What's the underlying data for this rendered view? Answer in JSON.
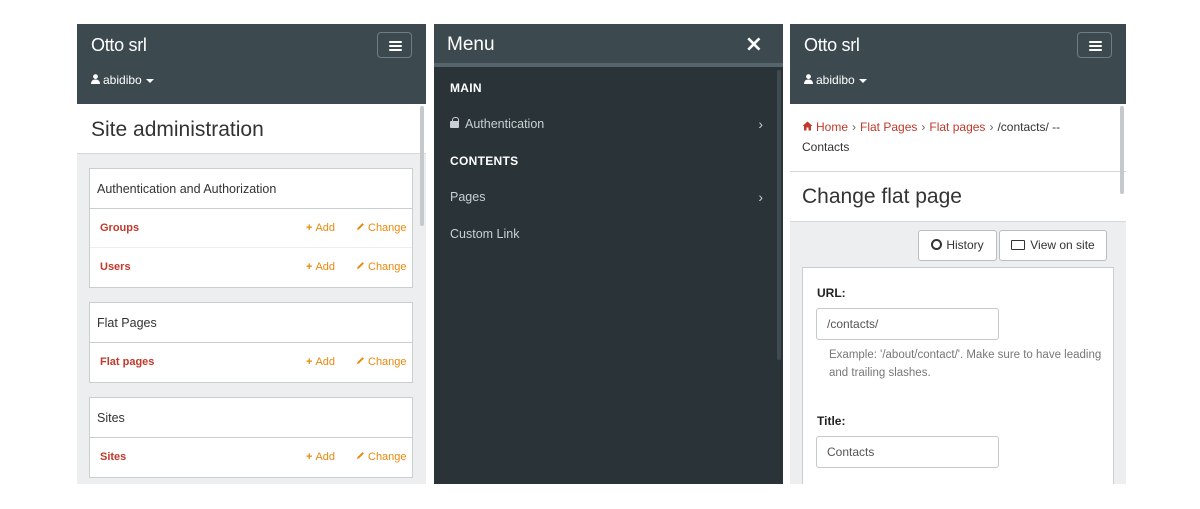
{
  "admin_panel": {
    "brand": "Otto srl",
    "user": "abidibo",
    "page_title": "Site administration",
    "modules": [
      {
        "title": "Authentication and Authorization",
        "rows": [
          {
            "name": "Groups",
            "add": "Add",
            "change": "Change"
          },
          {
            "name": "Users",
            "add": "Add",
            "change": "Change"
          }
        ]
      },
      {
        "title": "Flat Pages",
        "rows": [
          {
            "name": "Flat pages",
            "add": "Add",
            "change": "Change"
          }
        ]
      },
      {
        "title": "Sites",
        "rows": [
          {
            "name": "Sites",
            "add": "Add",
            "change": "Change"
          }
        ]
      }
    ]
  },
  "menu_panel": {
    "title": "Menu",
    "close_icon": "×",
    "sections": [
      {
        "label": "MAIN",
        "items": [
          {
            "label": "Authentication",
            "icon": "lock-icon",
            "chevron": "›"
          }
        ]
      },
      {
        "label": "CONTENTS",
        "items": [
          {
            "label": "Pages",
            "chevron": "›"
          },
          {
            "label": "Custom Link"
          }
        ]
      }
    ]
  },
  "edit_panel": {
    "brand": "Otto srl",
    "user": "abidibo",
    "breadcrumb": {
      "home": "Home",
      "flat_pages_app": "Flat Pages",
      "flat_pages": "Flat pages",
      "current": "/contacts/ --",
      "current_line2": "Contacts",
      "separator": "›"
    },
    "page_title": "Change flat page",
    "history_button": "History",
    "view_on_site_button": "View on site",
    "url_label": "URL:",
    "url_value": "/contacts/",
    "url_help": "Example: '/about/contact/'. Make sure to have leading and trailing slashes.",
    "title_label": "Title:",
    "title_value": "Contacts"
  },
  "colors": {
    "topbar": "#3c4a50",
    "menu_bg": "#2a3337",
    "link_red": "#c0392b",
    "action_orange": "#e8890c"
  }
}
